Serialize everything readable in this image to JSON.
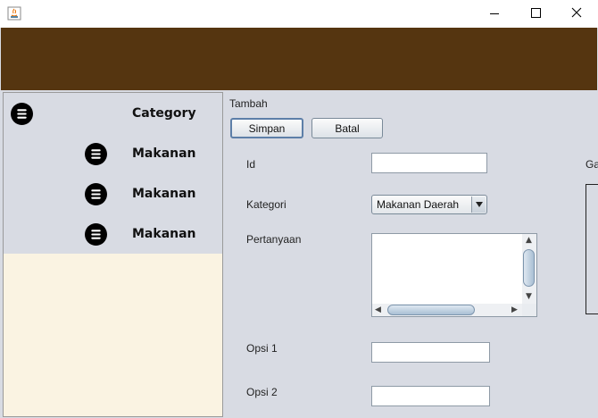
{
  "window": {
    "icons": [
      "java-app-icon",
      "minimize-icon",
      "maximize-icon",
      "close-icon"
    ]
  },
  "sidebar": {
    "header": {
      "label": "Category",
      "icon": "menu-icon"
    },
    "items": [
      {
        "label": "Makanan",
        "icon": "menu-icon"
      },
      {
        "label": "Makanan",
        "icon": "menu-icon"
      },
      {
        "label": "Makanan",
        "icon": "menu-icon"
      }
    ]
  },
  "form": {
    "title": "Tambah",
    "buttons": {
      "save": "Simpan",
      "cancel": "Batal"
    },
    "fields": {
      "id": {
        "label": "Id",
        "value": ""
      },
      "kategori": {
        "label": "Kategori",
        "value": "Makanan Daerah"
      },
      "pertanyaan": {
        "label": "Pertanyaan",
        "value": ""
      },
      "opsi1": {
        "label": "Opsi 1",
        "value": ""
      },
      "opsi2": {
        "label": "Opsi 2",
        "value": ""
      }
    },
    "side_label": "Ga"
  },
  "colors": {
    "banner": "#553510",
    "sidebar_bg": "#faf3e2",
    "panel_bg": "#d8dbe3"
  }
}
